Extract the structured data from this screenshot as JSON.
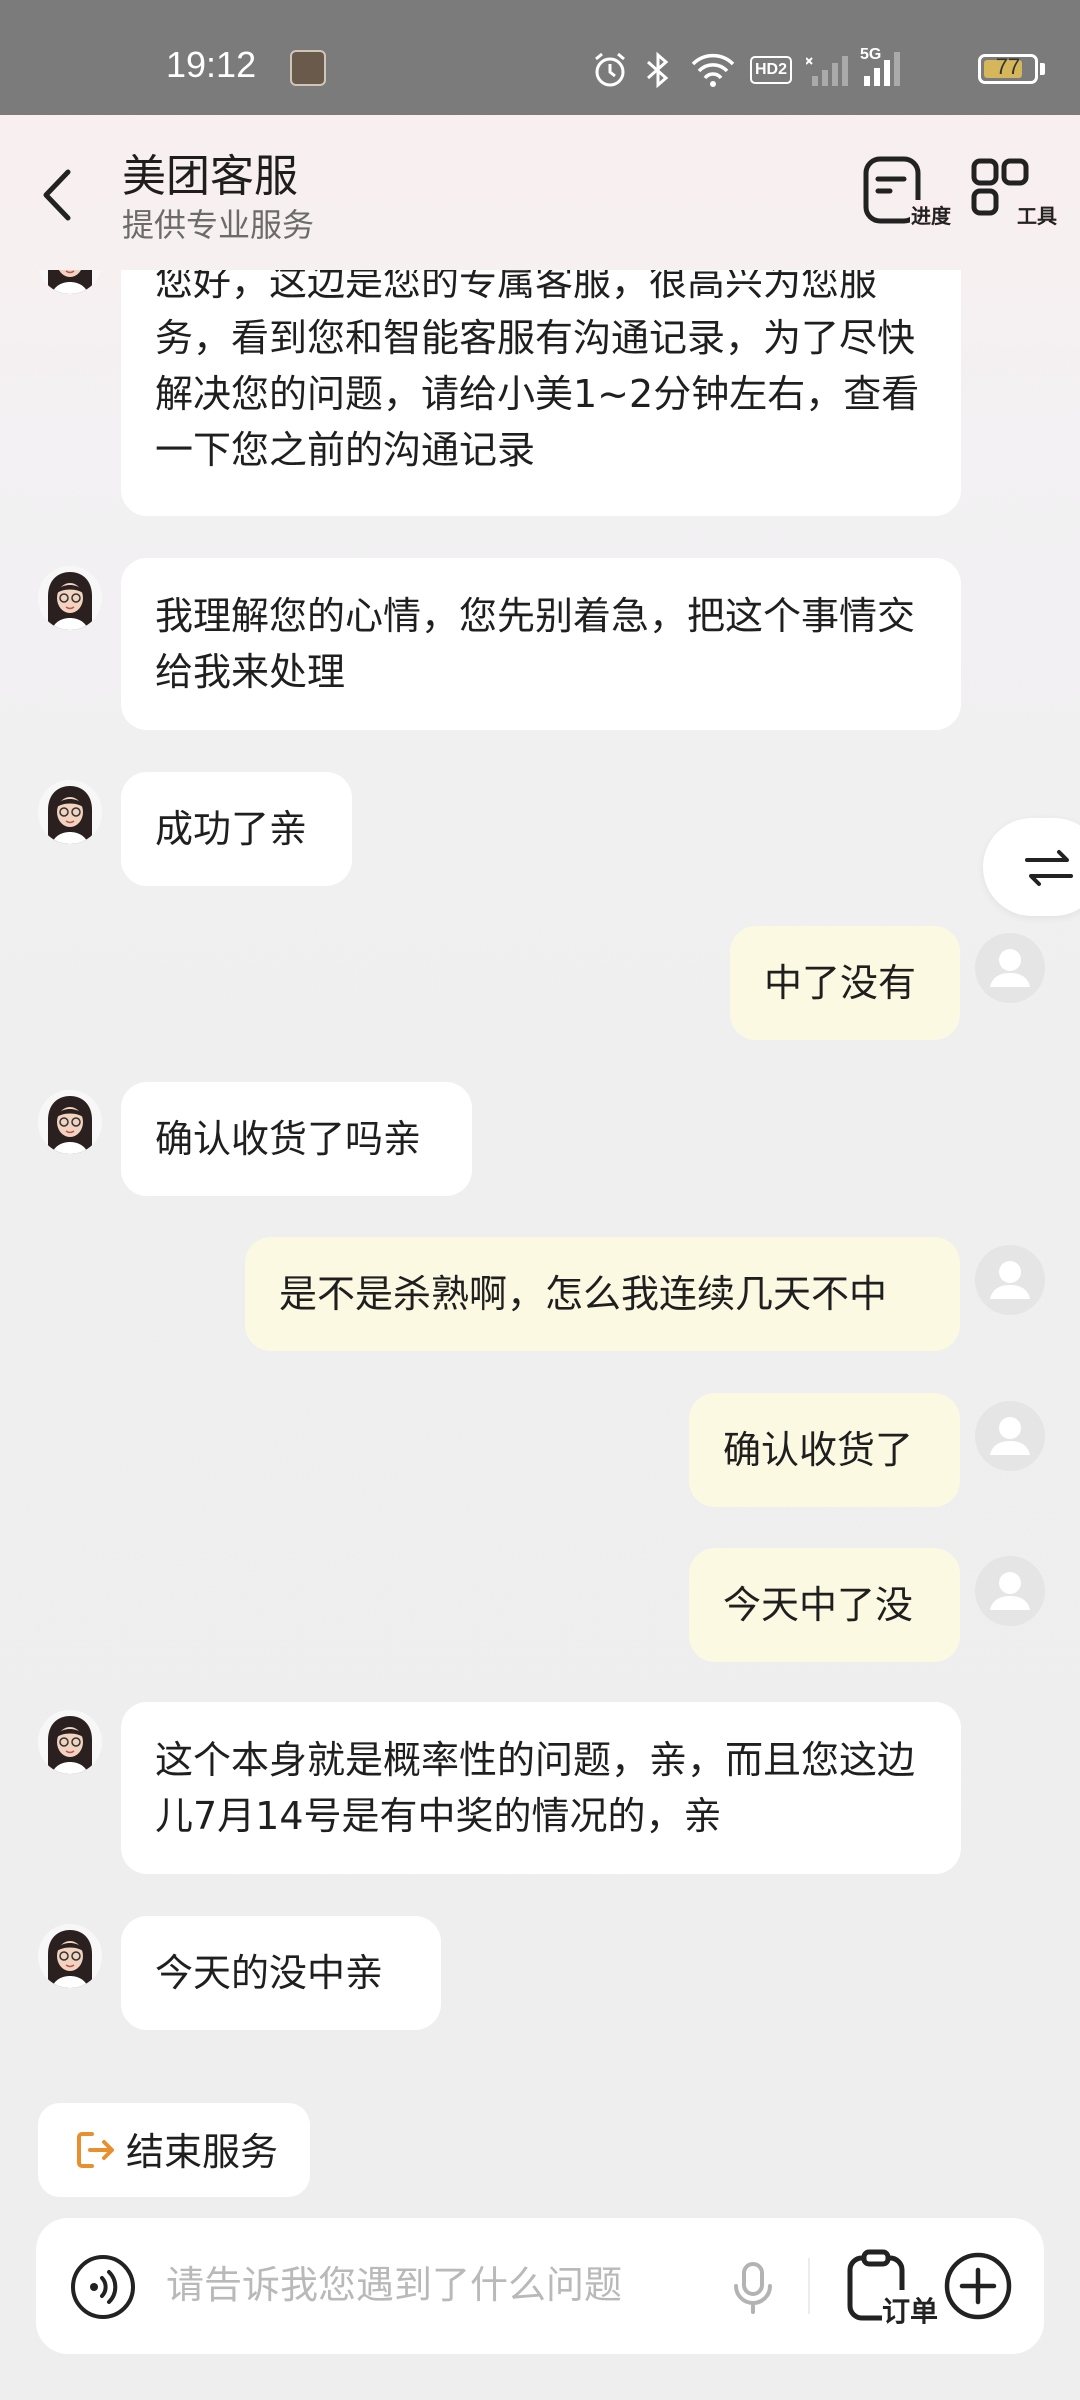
{
  "status_bar": {
    "time": "19:12",
    "network": "5G",
    "hd_badge": "HD2",
    "battery_level": "77",
    "icons": [
      "app-thumbnail-icon",
      "alarm-icon",
      "bluetooth-icon",
      "wifi-icon",
      "hd-icon",
      "signal-icon",
      "signal-5g-icon",
      "battery-icon"
    ]
  },
  "header": {
    "title": "美团客服",
    "subtitle": "提供专业服务",
    "progress_label": "进度",
    "tools_label": "工具"
  },
  "messages": [
    {
      "side": "left",
      "text": "您好，这边是您的专属客服，很高兴为您服务，看到您和智能客服有沟通记录，为了尽快解决您的问题，请给小美1~2分钟左右，查看一下您之前的沟通记录"
    },
    {
      "side": "left",
      "text": "我理解您的心情，您先别着急，把这个事情交给我来处理"
    },
    {
      "side": "left",
      "text": "成功了亲"
    },
    {
      "side": "right",
      "text": "中了没有"
    },
    {
      "side": "left",
      "text": "确认收货了吗亲"
    },
    {
      "side": "right",
      "text": "是不是杀熟啊，怎么我连续几天不中"
    },
    {
      "side": "right",
      "text": "确认收货了"
    },
    {
      "side": "right",
      "text": "今天中了没"
    },
    {
      "side": "left",
      "text": "这个本身就是概率性的问题，亲，而且您这边儿7月14号是有中奖的情况的，亲"
    },
    {
      "side": "left",
      "text": "今天的没中亲"
    }
  ],
  "end_service_label": "结束服务",
  "input": {
    "placeholder": "请告诉我您遇到了什么问题",
    "order_label": "订单"
  },
  "colors": {
    "user_bubble": "#fcf9e2",
    "agent_bubble": "#ffffff",
    "accent_orange": "#e8902e",
    "status_bar": "#7b7b7b"
  }
}
